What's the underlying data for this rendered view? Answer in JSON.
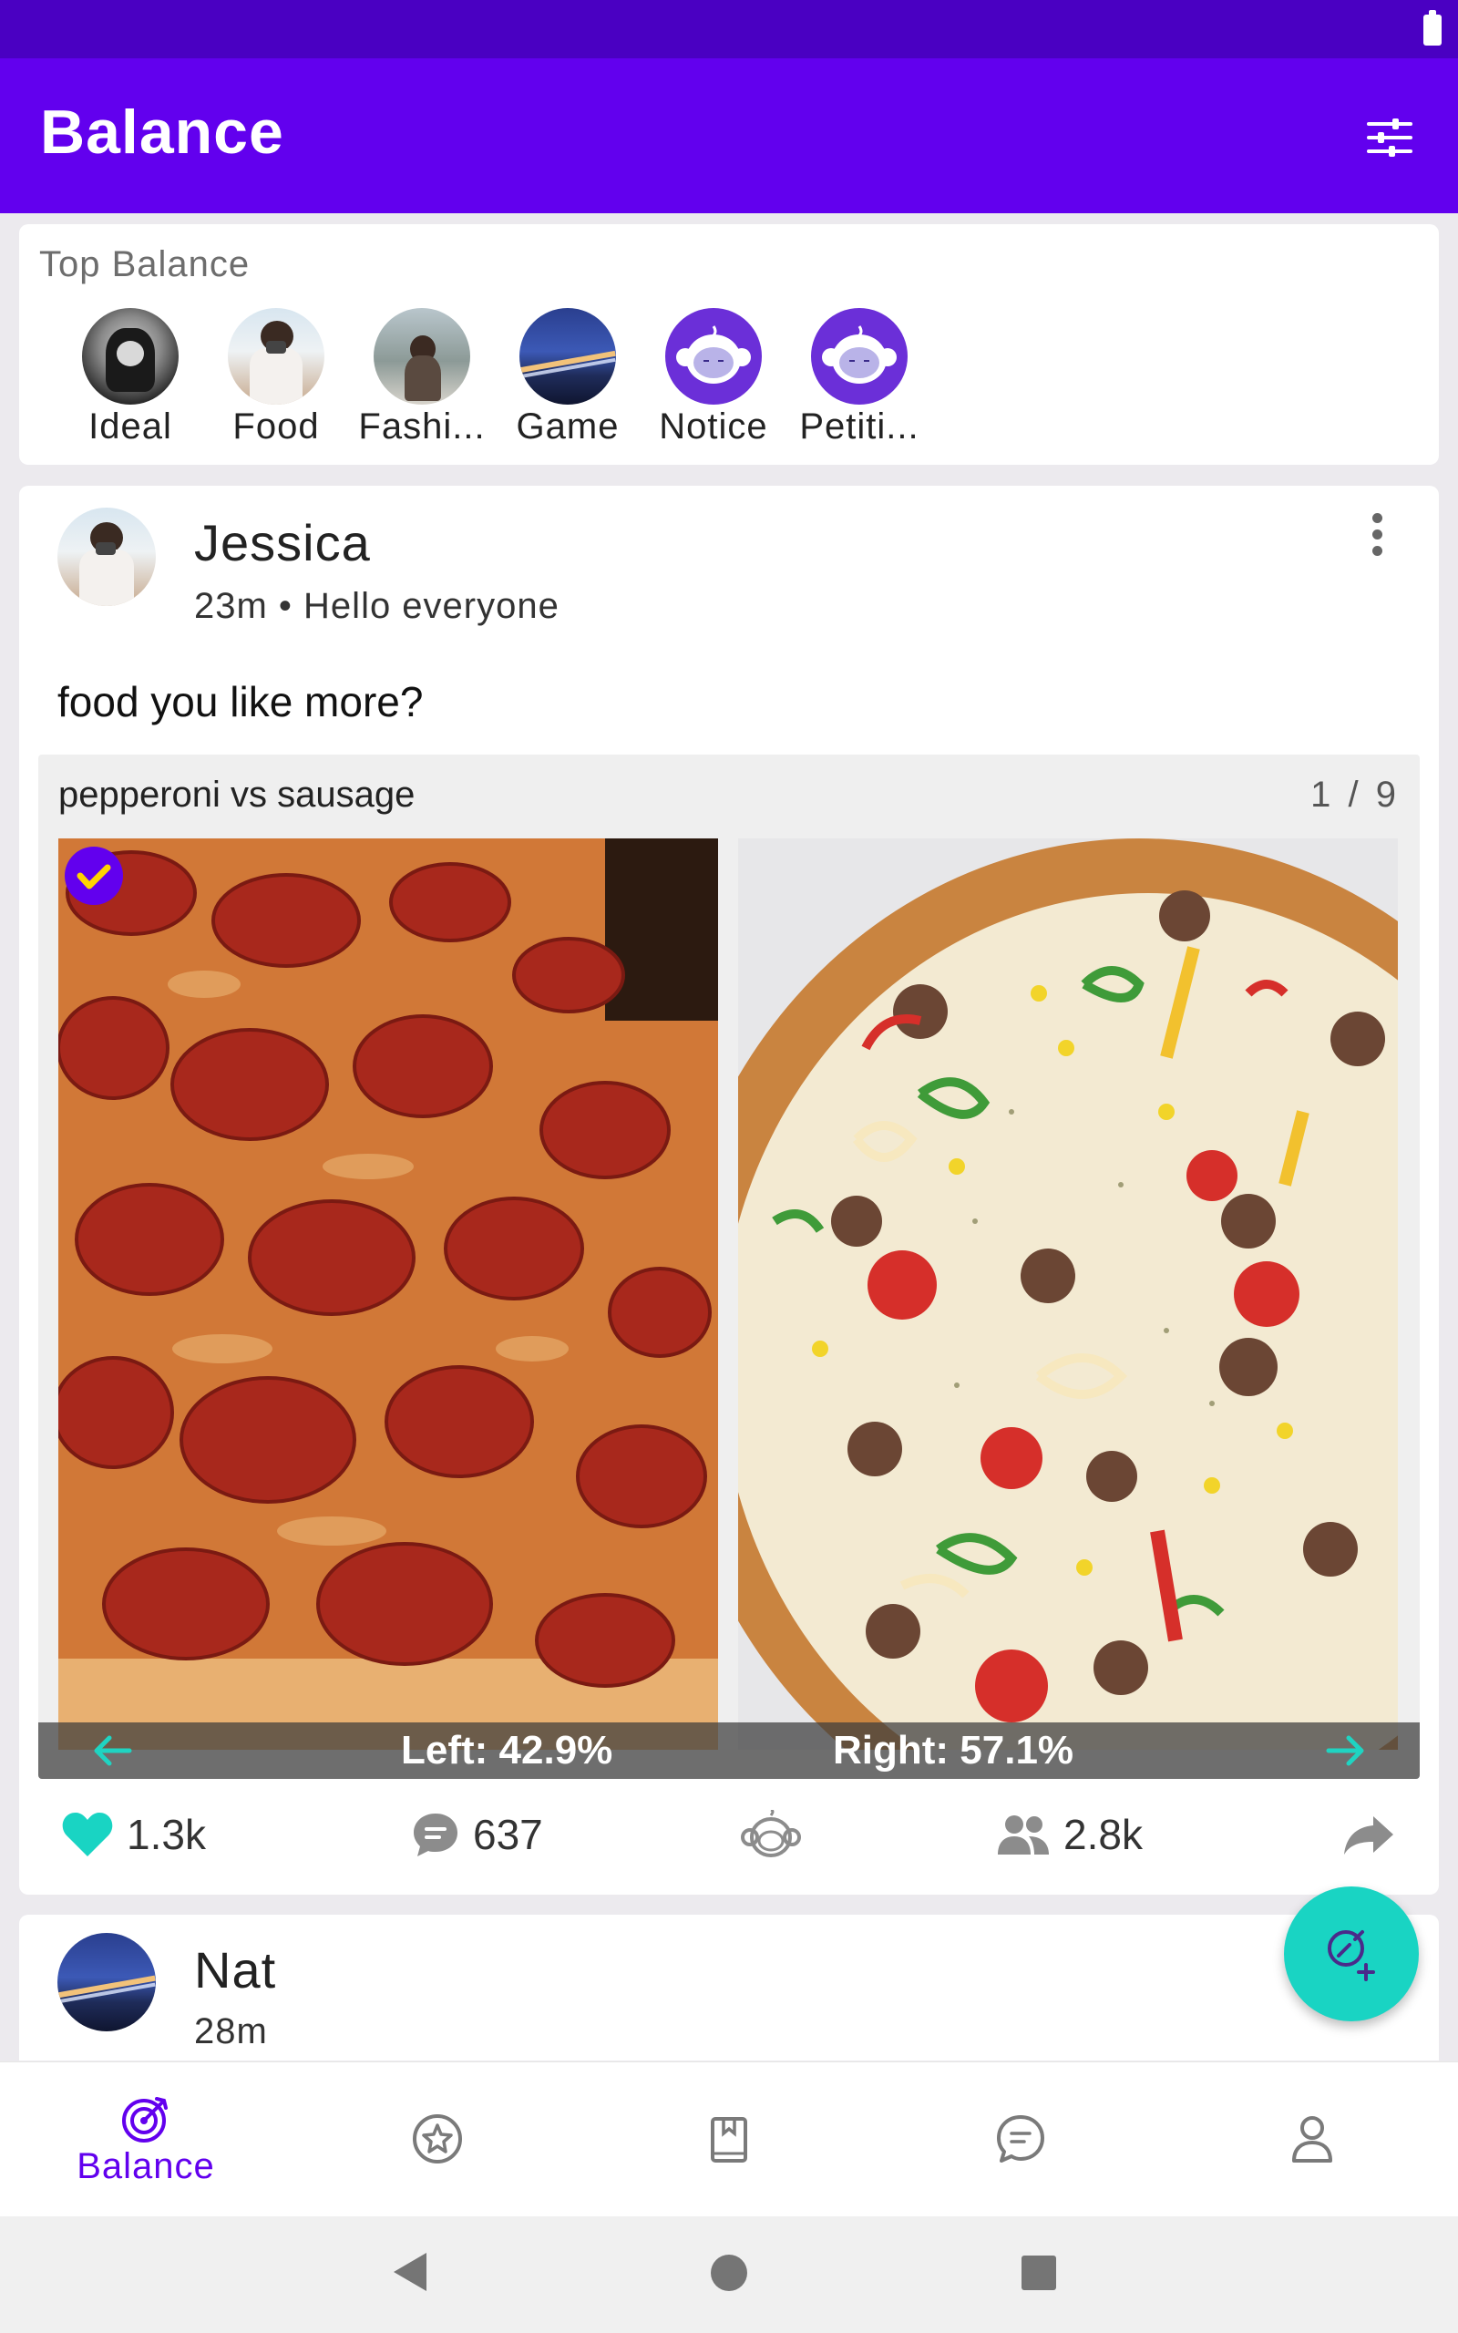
{
  "app": {
    "title": "Balance"
  },
  "top_balance": {
    "title": "Top Balance",
    "categories": [
      {
        "label": "Ideal"
      },
      {
        "label": "Food"
      },
      {
        "label": "Fashi..."
      },
      {
        "label": "Game"
      },
      {
        "label": "Notice"
      },
      {
        "label": "Petiti..."
      }
    ]
  },
  "post": {
    "user": "Jessica",
    "meta": "23m • Hello everyone",
    "question": "food you like more?",
    "vs_title": "pepperoni vs sausage",
    "page_counter": "1 / 9",
    "left_result": "Left: 42.9%",
    "right_result": "Right: 57.1%",
    "left_share": 42.9,
    "right_share": 57.1,
    "selected": "left",
    "likes": "1.3k",
    "comments": "637",
    "participants": "2.8k"
  },
  "post2": {
    "user": "Nat",
    "meta": "28m"
  },
  "bottom_nav": {
    "active_label": "Balance"
  },
  "colors": {
    "primary": "#6200ee",
    "status_bar": "#4a00c2",
    "accent": "#19d4c3"
  },
  "icons": [
    "filter-icon",
    "more-vert-icon",
    "check-icon",
    "arrow-left-icon",
    "arrow-right-icon",
    "heart-icon",
    "comment-icon",
    "monkey-icon",
    "group-icon",
    "share-icon",
    "edit-add-icon",
    "target-icon",
    "star-icon",
    "book-icon",
    "chat-icon",
    "person-icon"
  ]
}
